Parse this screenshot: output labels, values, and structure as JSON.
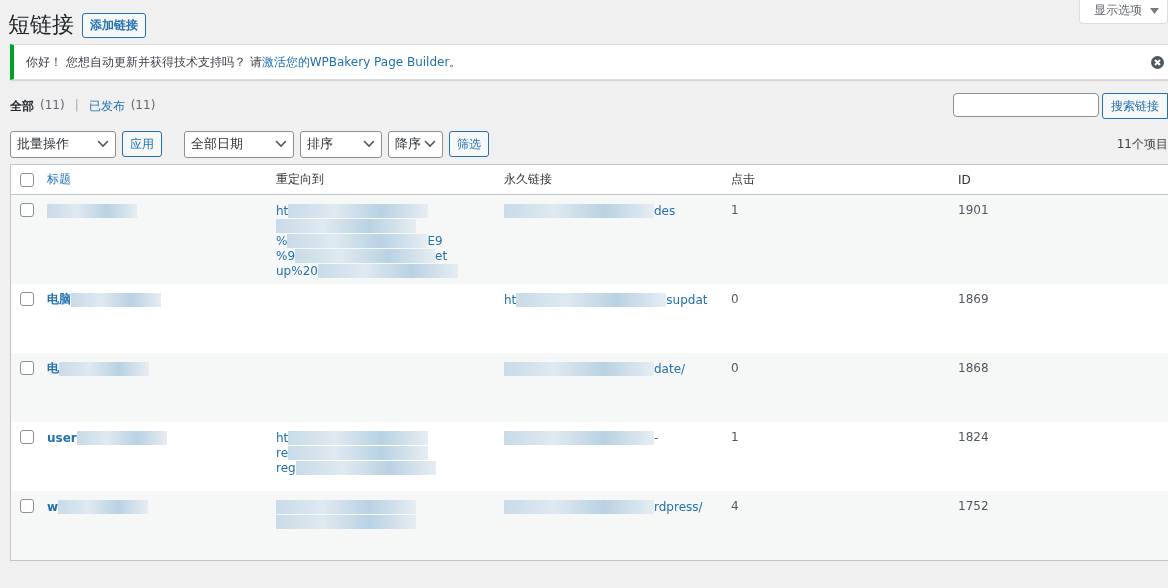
{
  "header": {
    "title": "短链接",
    "add_button": "添加链接",
    "screen_options": "显示选项"
  },
  "notice": {
    "text_before": "你好！ 您想自动更新并获得技术支持吗？ 请",
    "link": "激活您的WPBakery Page Builder",
    "text_after": "。"
  },
  "view_separator": "|",
  "views": [
    {
      "label": "全部",
      "count": "(11)",
      "selected": true
    },
    {
      "label": "已发布",
      "count": "(11)",
      "selected": false
    }
  ],
  "search": {
    "button": "搜索链接"
  },
  "filters": {
    "bulk_action": "批量操作",
    "apply": "应用",
    "date": "全部日期",
    "order_by": "排序",
    "order": "降序",
    "filter": "筛选",
    "item_count": "11个项目"
  },
  "table": {
    "select_all_checked": false,
    "columns": [
      "标题",
      "重定向到",
      "永久链接",
      "点击",
      "ID"
    ],
    "rows": [
      {
        "checked": false,
        "title": {
          "blurred": true
        },
        "redirect": [
          {
            "start": "ht"
          },
          {
            "blurred": true
          },
          {
            "start": "%",
            "end": "E9"
          },
          {
            "start": "%9",
            "end": "et"
          },
          {
            "start": "up%20"
          }
        ],
        "permalink": {
          "end": "des"
        },
        "clicks": "1",
        "id": "1901"
      },
      {
        "checked": false,
        "title": {
          "start": "电脑"
        },
        "redirect": [],
        "permalink": {
          "start": "ht",
          "end": "supdat"
        },
        "clicks": "0",
        "id": "1869"
      },
      {
        "checked": false,
        "title": {
          "start": "电"
        },
        "redirect": [],
        "permalink": {
          "end": "date/"
        },
        "clicks": "0",
        "id": "1868"
      },
      {
        "checked": false,
        "title": {
          "start": "user"
        },
        "redirect": [
          {
            "start": "ht"
          },
          {
            "start": "re"
          },
          {
            "start": "reg"
          }
        ],
        "permalink": {
          "end": "-"
        },
        "clicks": "1",
        "id": "1824"
      },
      {
        "checked": false,
        "title": {
          "start": "w"
        },
        "redirect": [
          {
            "blurred": true
          },
          {
            "blurred": true
          }
        ],
        "permalink": {
          "end": "rdpress/"
        },
        "clicks": "4",
        "id": "1752"
      }
    ]
  }
}
